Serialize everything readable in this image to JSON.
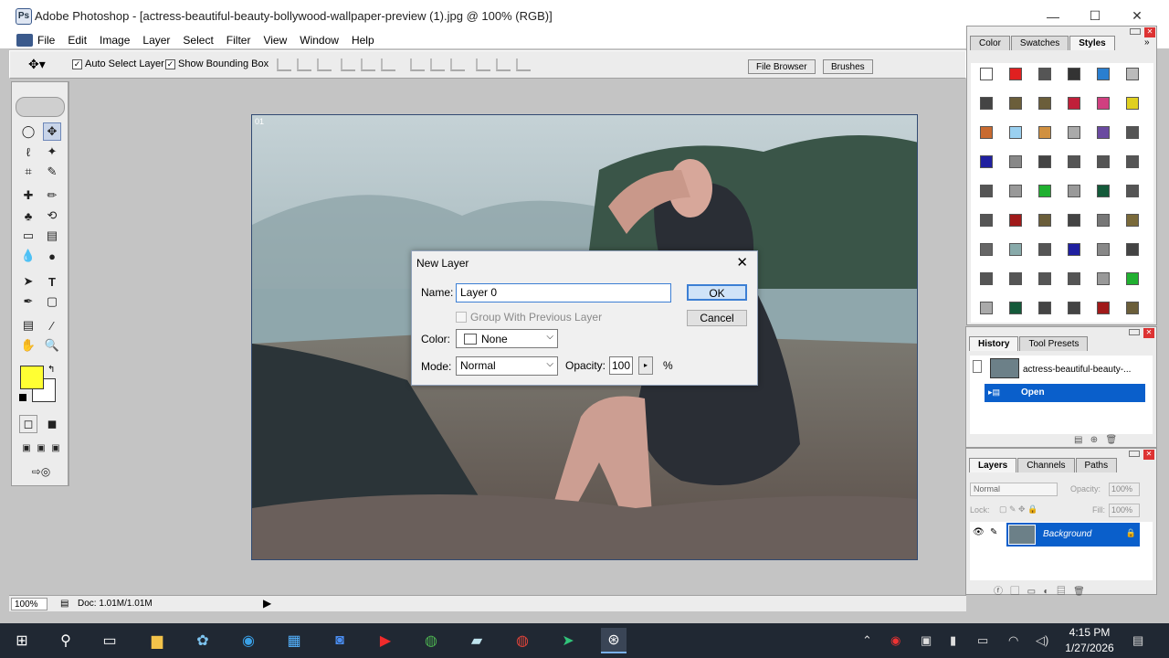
{
  "window": {
    "title": "Adobe Photoshop - [actress-beautiful-beauty-bollywood-wallpaper-preview (1).jpg @ 100% (RGB)]",
    "minimize": "—",
    "maximize": "☐",
    "close": "✕"
  },
  "menu": [
    "File",
    "Edit",
    "Image",
    "Layer",
    "Select",
    "Filter",
    "View",
    "Window",
    "Help"
  ],
  "options": {
    "auto_select_layer": "Auto Select Layer",
    "show_bounding_box": "Show Bounding Box",
    "auto_select_checked": true,
    "bounding_box_checked": true,
    "file_browser_tab": "File Browser",
    "brushes_tab": "Brushes"
  },
  "canvas": {
    "doc_tag": "01"
  },
  "dialog": {
    "title": "New Layer",
    "name_label": "Name:",
    "name_value": "Layer 0",
    "group_label": "Group With Previous Layer",
    "color_label": "Color:",
    "color_value": "None",
    "mode_label": "Mode:",
    "mode_value": "Normal",
    "opacity_label": "Opacity:",
    "opacity_value": "100",
    "opacity_unit": "%",
    "ok_label": "OK",
    "cancel_label": "Cancel"
  },
  "color_panel": {
    "tabs": [
      "Color",
      "Swatches",
      "Styles"
    ],
    "active_tab": "Styles"
  },
  "history_panel": {
    "tabs": [
      "History",
      "Tool Presets"
    ],
    "snapshot_label": "actress-beautiful-beauty-...",
    "states": [
      "Open"
    ]
  },
  "layers_panel": {
    "tabs": [
      "Layers",
      "Channels",
      "Paths"
    ],
    "blend_mode": "Normal",
    "opacity_label": "Opacity:",
    "opacity_value": "100%",
    "lock_label": "Lock:",
    "fill_label": "Fill:",
    "fill_value": "100%",
    "layer_name": "Background"
  },
  "status": {
    "zoom": "100%",
    "doc_info": "Doc: 1.01M/1.01M"
  },
  "taskbar": {
    "time": "4:15 PM",
    "date": "1/27/2026"
  },
  "colors": {
    "foreground": "#ffff33",
    "background": "#ffffff",
    "selection_blue": "#0a5fcb",
    "taskbar": "#202833"
  }
}
